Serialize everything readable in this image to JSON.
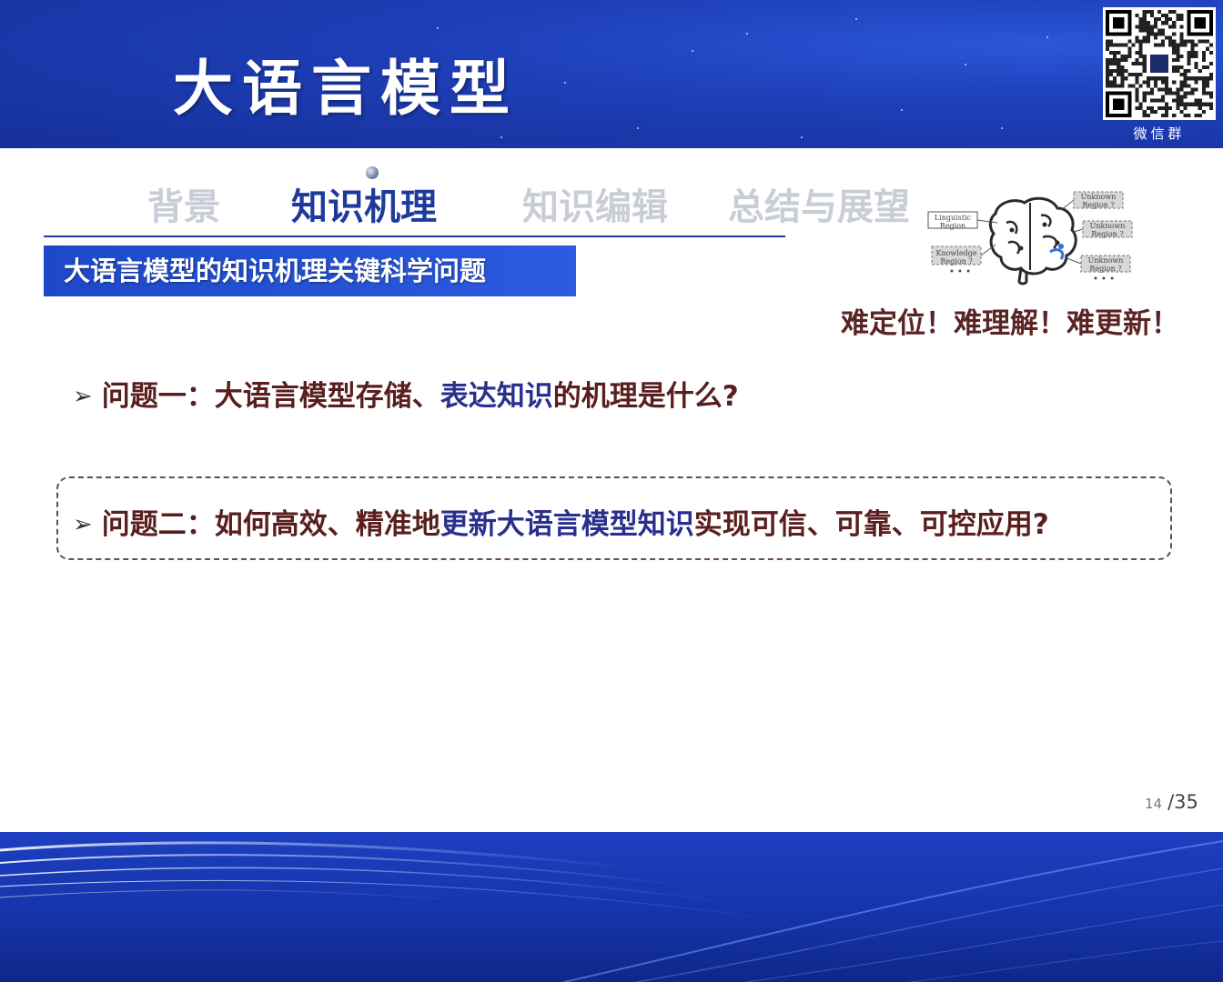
{
  "header": {
    "title": "大语言模型",
    "qr_caption": "微信群"
  },
  "nav": {
    "tabs": [
      {
        "label": "背景",
        "active": false
      },
      {
        "label": "知识机理",
        "active": true
      },
      {
        "label": "知识编辑",
        "active": false
      },
      {
        "label": "总结与展望",
        "active": false
      }
    ]
  },
  "section": {
    "banner": "大语言模型的知识机理关键科学问题"
  },
  "brain_diagram": {
    "labels": {
      "linguistic": [
        "Linguistic",
        "Region"
      ],
      "knowledge": [
        "Knowledge",
        "Region ?"
      ],
      "unknown1": [
        "Unknown",
        "Region ?"
      ],
      "unknown2": [
        "Unknown",
        "Region ?"
      ],
      "unknown3": [
        "Unknown",
        "Region ?"
      ]
    },
    "ellipsis": "• • •",
    "caption": "难定位！难理解！难更新！"
  },
  "questions": [
    {
      "prefix": "问题一：",
      "part1": "大语言模型存储、",
      "highlight": "表达知识",
      "part2": "的机理是什么?"
    },
    {
      "prefix": "问题二：",
      "part1": "如何高效、精准地",
      "highlight": "更新大语言模型知识",
      "part2": "实现可信、可靠、可控应用?"
    }
  ],
  "page": {
    "current": "14",
    "total": "/35"
  },
  "colors": {
    "header_blue": "#1e3fb8",
    "active_tab": "#1e3a9a",
    "inactive_tab": "#c9cdd6",
    "question_text": "#5a1e1e",
    "question_highlight": "#2a2f8e"
  }
}
